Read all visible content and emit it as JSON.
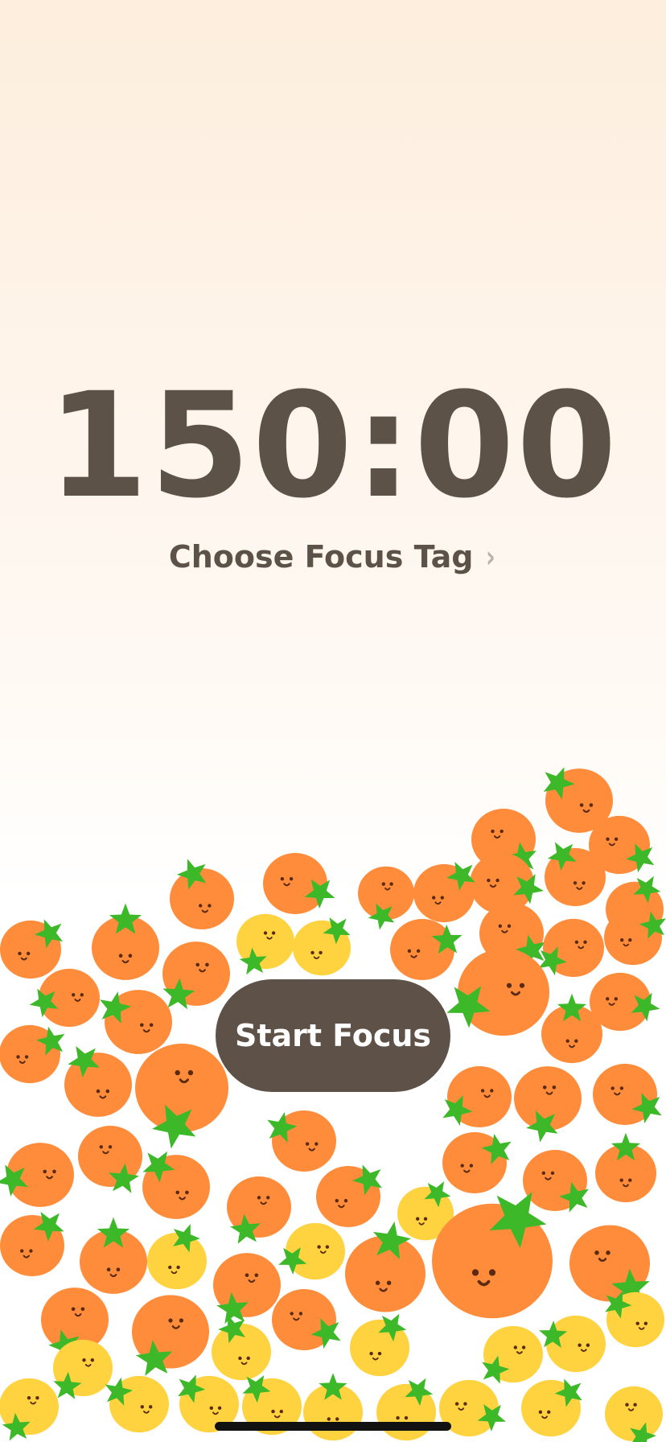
{
  "timer": {
    "time": "150:00"
  },
  "focus_tag": {
    "label": "Choose Focus Tag",
    "chevron": "›"
  },
  "start_button": {
    "label": "Start Focus"
  },
  "icons": {
    "chevron": "chevron-right-icon",
    "fruit": "tomato-icon"
  },
  "colors": {
    "text": "#5d5248",
    "button": "#5e5147",
    "tomato_orange": "#ff8c3a",
    "tomato_yellow": "#ffd23f",
    "leaf": "#3db829",
    "face": "#5a2a12"
  }
}
